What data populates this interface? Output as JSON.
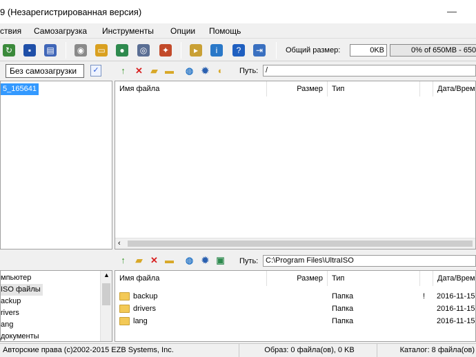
{
  "window": {
    "title": "9 (Незарегистрированная версия)",
    "minimize": "—"
  },
  "menu": [
    "ствия",
    "Самозагрузка",
    "Инструменты",
    "Опции",
    "Помощь"
  ],
  "toolbar": {
    "icons": [
      "open-icon",
      "save-icon",
      "save-as-icon",
      "disk-image-icon",
      "burn-icon",
      "mount-icon",
      "virtual-drive-icon",
      "compress-icon",
      "properties-icon",
      "info-icon",
      "help-icon",
      "exit-icon"
    ],
    "total_size_label": "Общий размер:",
    "total_size_value": "0KB",
    "progress_text": "0% of 650MB - 650"
  },
  "boot": {
    "label": "Без самозагрузки"
  },
  "top_pane": {
    "path_label": "Путь:",
    "path_value": "/",
    "tree_items": [
      {
        "label": "5_165641",
        "selected": true
      }
    ],
    "columns": [
      "Имя файла",
      "Размер",
      "Тип",
      "Дата/Врем"
    ],
    "rows": []
  },
  "bottom_pane": {
    "path_label": "Путь:",
    "path_value": "C:\\Program Files\\UltraISO",
    "tree_items": [
      {
        "label": "мпьютер"
      },
      {
        "label": "ISO файлы"
      },
      {
        "label": "ackup"
      },
      {
        "label": "rivers"
      },
      {
        "label": "ang"
      },
      {
        "label": "документы"
      }
    ],
    "columns": [
      "Имя файла",
      "Размер",
      "Тип",
      "Дата/Врем"
    ],
    "rows": [
      {
        "name": "backup",
        "size": "",
        "type": "Папка",
        "flag": "!",
        "date": "2016-11-15"
      },
      {
        "name": "drivers",
        "size": "",
        "type": "Папка",
        "flag": "",
        "date": "2016-11-15"
      },
      {
        "name": "lang",
        "size": "",
        "type": "Папка",
        "flag": "",
        "date": "2016-11-15"
      }
    ]
  },
  "status": {
    "copyright": "Авторские права (c)2002-2015 EZB Systems, Inc.",
    "image_info": "Образ: 0 файла(ов), 0 KB",
    "catalog_info": "Каталог: 8 файла(ов)"
  }
}
